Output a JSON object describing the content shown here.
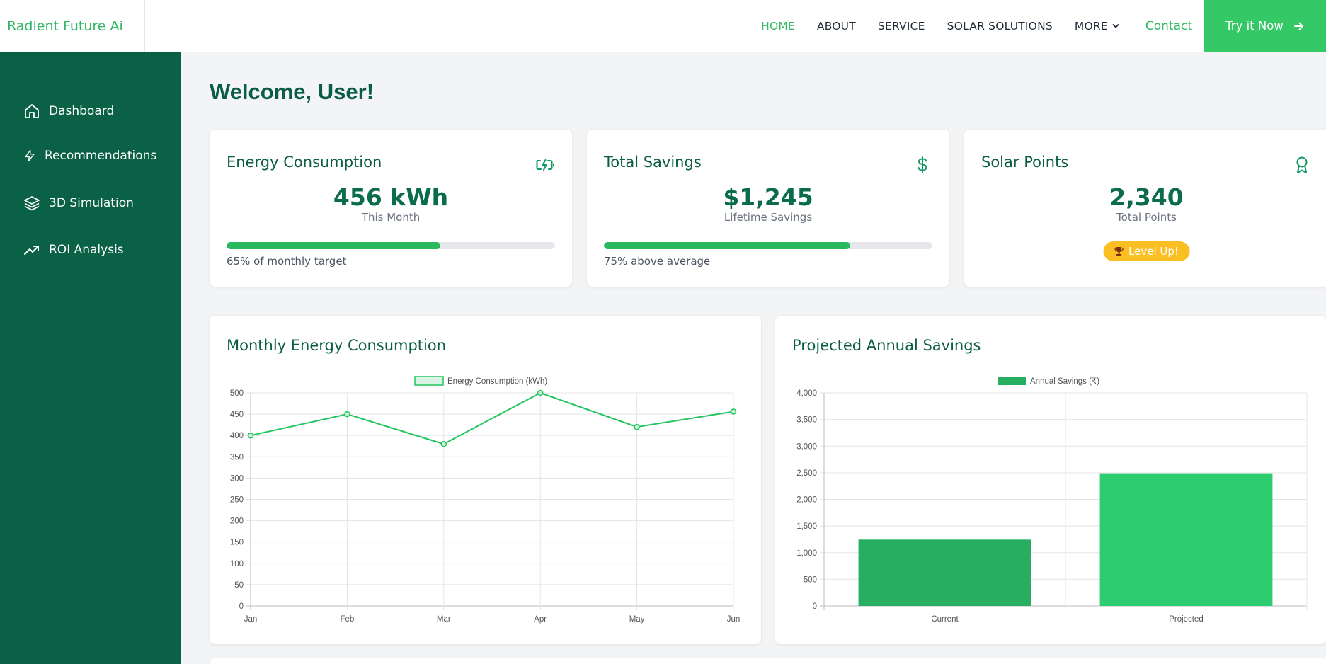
{
  "nav": {
    "brand": "Radient Future Ai",
    "links": [
      "HOME",
      "ABOUT",
      "SERVICE",
      "SOLAR SOLUTIONS"
    ],
    "more_label": "MORE",
    "contact_label": "Contact",
    "cta_label": "Try it Now"
  },
  "sidebar": {
    "items": [
      {
        "label": "Dashboard",
        "icon": "home-icon"
      },
      {
        "label": "Recommendations",
        "icon": "bolt-icon"
      },
      {
        "label": "3D Simulation",
        "icon": "layers-icon"
      },
      {
        "label": "ROI Analysis",
        "icon": "trending-up-icon"
      }
    ]
  },
  "main": {
    "welcome": "Welcome, User!",
    "cards": [
      {
        "title": "Energy Consumption",
        "value": "456 kWh",
        "sub": "This Month",
        "progress": 0.65,
        "note": "65% of monthly target",
        "icon": "battery-charging-icon"
      },
      {
        "title": "Total Savings",
        "value": "$1,245",
        "sub": "Lifetime Savings",
        "progress": 0.75,
        "note": "75% above average",
        "icon": "dollar-icon"
      },
      {
        "title": "Solar Points",
        "value": "2,340",
        "sub": "Total Points",
        "badge": "Level Up!",
        "icon": "award-icon"
      }
    ],
    "charts_titles": [
      "Monthly Energy Consumption",
      "Projected Annual Savings"
    ]
  },
  "colors": {
    "brand_green": "#2fb765",
    "sidebar_bg": "#0b6146",
    "title_green": "#0b5e43",
    "line_green": "#22c55e",
    "bar_current": "#27ae60",
    "bar_projected": "#2ecc71",
    "badge_yellow": "#fbbf24"
  },
  "chart_data": [
    {
      "type": "line",
      "title": "Monthly Energy Consumption",
      "categories": [
        "Jan",
        "Feb",
        "Mar",
        "Apr",
        "May",
        "Jun"
      ],
      "series": [
        {
          "name": "Energy Consumption (kWh)",
          "values": [
            400,
            450,
            380,
            500,
            420,
            456
          ]
        }
      ],
      "ylim": [
        0,
        500
      ],
      "yticks": [
        "0",
        "50",
        "100",
        "150",
        "200",
        "250",
        "300",
        "350",
        "400",
        "450",
        "500"
      ],
      "legend": "top-center",
      "grid": true
    },
    {
      "type": "bar",
      "title": "Projected Annual Savings",
      "categories": [
        "Current",
        "Projected"
      ],
      "series": [
        {
          "name": "Annual Savings (₹)",
          "values": [
            1245,
            2490
          ]
        }
      ],
      "ylim": [
        0,
        4000
      ],
      "yticks": [
        "0",
        "500",
        "1,000",
        "1,500",
        "2,000",
        "2,500",
        "3,000",
        "3,500",
        "4,000"
      ],
      "legend": "top-center",
      "grid": true
    }
  ]
}
